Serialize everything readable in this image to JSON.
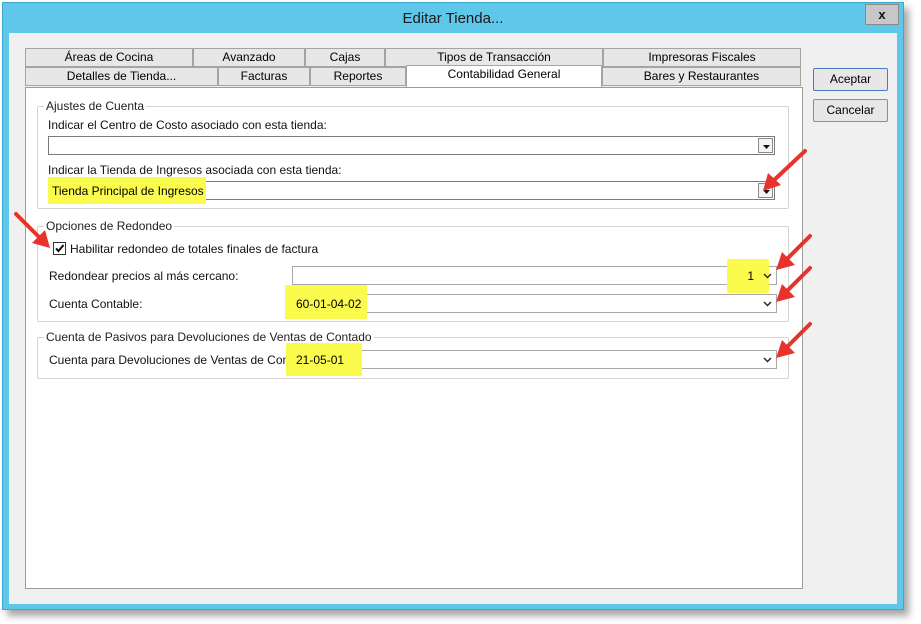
{
  "window": {
    "title": "Editar Tienda...",
    "close_label": "x"
  },
  "tabs_row1": [
    {
      "label": "Áreas de Cocina"
    },
    {
      "label": "Avanzado"
    },
    {
      "label": "Cajas"
    },
    {
      "label": "Tipos de Transacción"
    },
    {
      "label": "Impresoras Fiscales"
    }
  ],
  "tabs_row2": [
    {
      "label": "Detalles de Tienda..."
    },
    {
      "label": "Facturas"
    },
    {
      "label": "Reportes"
    },
    {
      "label": "Contabilidad General"
    },
    {
      "label": "Bares y Restaurantes"
    }
  ],
  "active_tab": "Contabilidad General",
  "ajustes": {
    "legend": "Ajustes de Cuenta",
    "cost_center_label": "Indicar el Centro de Costo asociado con esta tienda:",
    "cost_center_value": "",
    "income_store_label": "Indicar la Tienda de Ingresos asociada con esta tienda:",
    "income_store_value": "Tienda Principal de Ingresos"
  },
  "redondeo": {
    "legend": "Opciones de Redondeo",
    "enable_label": "Habilitar redondeo de totales finales de factura",
    "enable_checked": true,
    "nearest_label": "Redondear precios al más cercano:",
    "nearest_value": "1",
    "account_label": "Cuenta Contable:",
    "account_value": "60-01-04-02"
  },
  "pasivos": {
    "legend": "Cuenta de Pasivos para Devoluciones de Ventas de Contado",
    "returns_label": "Cuenta para Devoluciones de Ventas de Contado:",
    "returns_value": "21-05-01"
  },
  "buttons": {
    "accept": "Aceptar",
    "cancel": "Cancelar"
  },
  "colors": {
    "titlebar": "#5fc7ea",
    "highlight": "#fbfb4e",
    "annotation_arrow": "#e8322b"
  }
}
